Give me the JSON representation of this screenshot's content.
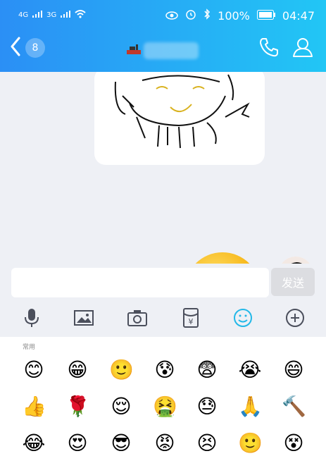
{
  "status": {
    "network": [
      "4G",
      "3G"
    ],
    "battery": "100%",
    "time": "04:47",
    "icons": [
      "eye-icon",
      "alarm-icon",
      "bluetooth-icon",
      "battery-icon",
      "wifi-icon"
    ]
  },
  "header": {
    "back_count": "8",
    "icons": [
      "back-chevron-icon",
      "phone-icon",
      "profile-icon"
    ],
    "accent": "#2b8ff5"
  },
  "composer": {
    "send_label": "发送",
    "placeholder": ""
  },
  "toolbar": {
    "items": [
      "mic-icon",
      "image-icon",
      "camera-icon",
      "red-packet-icon",
      "emoji-icon",
      "plus-icon"
    ],
    "active": "emoji-icon",
    "active_color": "#22b8e8"
  },
  "emoji_panel": {
    "section_label": "常用",
    "rows": [
      [
        "😊",
        "😁",
        "🙂",
        "😰",
        "😨",
        "😭",
        "😄"
      ],
      [
        "👍",
        "🌹",
        "😌",
        "🤮",
        "😓",
        "🙏",
        "🔨"
      ],
      [
        "😂",
        "😍",
        "😎",
        "😡",
        "😣",
        "🙂",
        "😵"
      ]
    ]
  }
}
